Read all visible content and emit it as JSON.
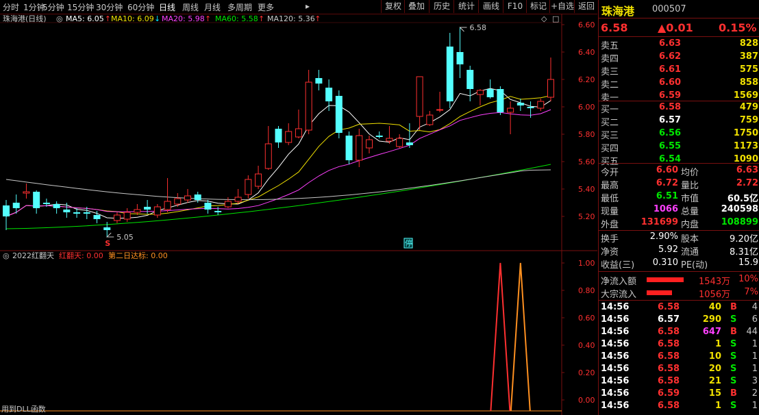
{
  "toolbar": {
    "periods": [
      "分时",
      "1分钟",
      "5分钟",
      "15分钟",
      "30分钟",
      "60分钟",
      "日线",
      "周线",
      "月线",
      "多周期",
      "更多"
    ],
    "active": "日线",
    "right_buttons": [
      "复权",
      "叠加",
      "历史",
      "统计",
      "画线",
      "F10",
      "标记",
      "+自选",
      "返回"
    ]
  },
  "chart": {
    "stock_label": "珠海港(日线)",
    "ma": [
      {
        "label": "MA5: 6.05",
        "arrow": "↑",
        "color": "#ffffff"
      },
      {
        "label": "MA10: 6.09",
        "arrow": "↓",
        "color": "#f0e000"
      },
      {
        "label": "MA20: 5.98",
        "arrow": "↑",
        "color": "#ff40ff"
      },
      {
        "label": "MA60: 5.58",
        "arrow": "↑",
        "color": "#00e600"
      },
      {
        "label": "MA120: 5.36",
        "arrow": "↑",
        "color": "#c8c8c8"
      }
    ],
    "price_ticks": [
      "6.60",
      "6.40",
      "6.20",
      "6.00",
      "5.80",
      "5.60",
      "5.40",
      "5.20"
    ],
    "high_label": "6.58",
    "low_label": "5.05",
    "stop_badge": "停",
    "s_marker": "S",
    "indicator_name": "2022红翻天",
    "indicator_v1": "红翻天: 0.00",
    "indicator_v2": "第二日达标: 0.00",
    "indicator_ticks": [
      "1.00",
      "0.80",
      "0.60",
      "0.40",
      "0.20",
      "0.00"
    ],
    "footer_note": "用到DLL函数",
    "candles": [
      [
        5.28,
        5.2,
        5.32,
        5.1
      ],
      [
        5.3,
        5.26,
        5.36,
        5.22
      ],
      [
        5.37,
        5.38,
        5.44,
        5.33
      ],
      [
        5.38,
        5.26,
        5.39,
        5.22
      ],
      [
        5.3,
        5.29,
        5.33,
        5.27
      ],
      [
        5.29,
        5.26,
        5.31,
        5.22
      ],
      [
        5.25,
        5.23,
        5.3,
        5.19
      ],
      [
        5.23,
        5.22,
        5.26,
        5.19
      ],
      [
        5.23,
        5.22,
        5.27,
        5.18
      ],
      [
        5.21,
        5.18,
        5.24,
        5.15
      ],
      [
        5.12,
        5.1,
        5.16,
        5.05
      ],
      [
        5.17,
        5.21,
        5.23,
        5.15
      ],
      [
        5.18,
        5.23,
        5.26,
        5.16
      ],
      [
        5.23,
        5.25,
        5.29,
        5.21
      ],
      [
        5.27,
        5.25,
        5.32,
        5.22
      ],
      [
        5.21,
        5.27,
        5.29,
        5.19
      ],
      [
        5.25,
        5.31,
        5.48,
        5.23
      ],
      [
        5.29,
        5.33,
        5.37,
        5.27
      ],
      [
        5.32,
        5.35,
        5.4,
        5.3
      ],
      [
        5.36,
        5.32,
        5.38,
        5.3
      ],
      [
        5.3,
        5.25,
        5.32,
        5.22
      ],
      [
        5.24,
        5.23,
        5.27,
        5.21
      ],
      [
        5.27,
        5.31,
        5.34,
        5.26
      ],
      [
        5.31,
        5.34,
        5.4,
        5.29
      ],
      [
        5.36,
        5.47,
        5.5,
        5.33
      ],
      [
        5.42,
        5.51,
        5.57,
        5.4
      ],
      [
        5.55,
        5.73,
        5.86,
        5.54
      ],
      [
        5.84,
        5.74,
        5.86,
        5.7
      ],
      [
        5.74,
        5.82,
        5.88,
        5.72
      ],
      [
        5.78,
        5.84,
        5.98,
        5.77
      ],
      [
        5.83,
        6.18,
        6.27,
        5.8
      ],
      [
        6.21,
        6.17,
        6.27,
        6.12
      ],
      [
        6.14,
        6.04,
        6.2,
        5.97
      ],
      [
        6.08,
        5.81,
        6.12,
        5.77
      ],
      [
        5.79,
        5.61,
        5.82,
        5.58
      ],
      [
        5.61,
        5.79,
        5.84,
        5.56
      ],
      [
        5.7,
        5.76,
        5.79,
        5.66
      ],
      [
        5.79,
        5.78,
        5.82,
        5.77
      ],
      [
        5.75,
        5.77,
        5.86,
        5.73
      ],
      [
        5.71,
        5.77,
        5.8,
        5.7
      ],
      [
        5.74,
        5.72,
        5.88,
        5.7
      ],
      [
        5.93,
        6.22,
        6.22,
        5.83
      ],
      [
        5.87,
        5.94,
        5.97,
        5.86
      ],
      [
        5.98,
        5.98,
        6.11,
        5.96
      ],
      [
        6.44,
        6.04,
        6.54,
        5.99
      ],
      [
        6.4,
        6.31,
        6.58,
        6.21
      ],
      [
        6.27,
        6.13,
        6.3,
        6.04
      ],
      [
        6.09,
        6.12,
        6.13,
        6.01
      ],
      [
        6.13,
        6.07,
        6.2,
        6.06
      ],
      [
        6.13,
        5.96,
        6.15,
        5.94
      ],
      [
        5.96,
        5.99,
        6.04,
        5.8
      ],
      [
        6.03,
        6.01,
        6.06,
        5.97
      ],
      [
        6.0,
        5.99,
        6.04,
        5.92
      ],
      [
        5.99,
        6.04,
        6.06,
        5.97
      ],
      [
        6.07,
        6.2,
        6.36,
        6.04
      ]
    ],
    "ind_peaks": [
      {
        "i": 49,
        "v": 1.0,
        "c": "#ff3030"
      },
      {
        "i": 51,
        "v": 1.0,
        "c": "#ff9020"
      }
    ]
  },
  "quote": {
    "name": "珠海港",
    "code": "000507",
    "price": "6.58",
    "change": "▲0.01",
    "pct": "0.15%",
    "asks": [
      {
        "l": "卖五",
        "p": "6.63",
        "v": "828"
      },
      {
        "l": "卖四",
        "p": "6.62",
        "v": "387"
      },
      {
        "l": "卖三",
        "p": "6.61",
        "v": "575"
      },
      {
        "l": "卖二",
        "p": "6.60",
        "v": "858"
      },
      {
        "l": "卖一",
        "p": "6.59",
        "v": "1569"
      }
    ],
    "bids": [
      {
        "l": "买一",
        "p": "6.58",
        "v": "479",
        "pc": "red"
      },
      {
        "l": "买二",
        "p": "6.57",
        "v": "759",
        "pc": "white"
      },
      {
        "l": "买三",
        "p": "6.56",
        "v": "1750",
        "pc": "green"
      },
      {
        "l": "买四",
        "p": "6.55",
        "v": "1173",
        "pc": "green"
      },
      {
        "l": "买五",
        "p": "6.54",
        "v": "1090",
        "pc": "green"
      }
    ],
    "stats": [
      {
        "l1": "今开",
        "v1": "6.60",
        "c1": "red",
        "l2": "均价",
        "v2": "6.63",
        "c2": "red"
      },
      {
        "l1": "最高",
        "v1": "6.72",
        "c1": "red",
        "l2": "量比",
        "v2": "2.72",
        "c2": "red"
      },
      {
        "l1": "最低",
        "v1": "6.51",
        "c1": "green",
        "l2": "市值",
        "v2": "60.5亿",
        "c2": "white"
      },
      {
        "l1": "现量",
        "v1": "1066",
        "c1": "mag",
        "l2": "总量",
        "v2": "240598",
        "c2": "white"
      },
      {
        "l1": "外盘",
        "v1": "131699",
        "c1": "red",
        "l2": "内盘",
        "v2": "108899",
        "c2": "green"
      }
    ],
    "fin": [
      {
        "l1": "换手",
        "v1": "2.90%",
        "l2": "股本",
        "v2": "9.20亿"
      },
      {
        "l1": "净资",
        "v1": "5.92",
        "l2": "流通",
        "v2": "8.31亿"
      },
      {
        "l1": "收益(三)",
        "v1": "0.310",
        "l2": "PE(动)",
        "v2": "15.9"
      }
    ],
    "flows": [
      {
        "l": "净流入额",
        "amt": "1543万",
        "pct": "10%",
        "bar": 1.0
      },
      {
        "l": "大宗流入",
        "amt": "1056万",
        "pct": "7%",
        "bar": 0.68
      }
    ],
    "ticks": [
      {
        "t": "14:56",
        "p": "6.58",
        "pc": "red",
        "v": "40",
        "vc": "yellow",
        "d": "B",
        "dc": "red",
        "n": "4"
      },
      {
        "t": "14:56",
        "p": "6.57",
        "pc": "white",
        "v": "290",
        "vc": "yellow",
        "d": "S",
        "dc": "green",
        "n": "6"
      },
      {
        "t": "14:56",
        "p": "6.58",
        "pc": "red",
        "v": "647",
        "vc": "mag",
        "d": "B",
        "dc": "red",
        "n": "44"
      },
      {
        "t": "14:56",
        "p": "6.58",
        "pc": "red",
        "v": "1",
        "vc": "yellow",
        "d": "S",
        "dc": "green",
        "n": "1"
      },
      {
        "t": "14:56",
        "p": "6.58",
        "pc": "red",
        "v": "10",
        "vc": "yellow",
        "d": "S",
        "dc": "green",
        "n": "1"
      },
      {
        "t": "14:56",
        "p": "6.58",
        "pc": "red",
        "v": "20",
        "vc": "yellow",
        "d": "S",
        "dc": "green",
        "n": "1"
      },
      {
        "t": "14:56",
        "p": "6.58",
        "pc": "red",
        "v": "21",
        "vc": "yellow",
        "d": "S",
        "dc": "green",
        "n": "3"
      },
      {
        "t": "14:56",
        "p": "6.59",
        "pc": "red",
        "v": "15",
        "vc": "yellow",
        "d": "B",
        "dc": "red",
        "n": "2"
      },
      {
        "t": "14:56",
        "p": "6.58",
        "pc": "red",
        "v": "1",
        "vc": "yellow",
        "d": "S",
        "dc": "green",
        "n": "1"
      }
    ]
  }
}
